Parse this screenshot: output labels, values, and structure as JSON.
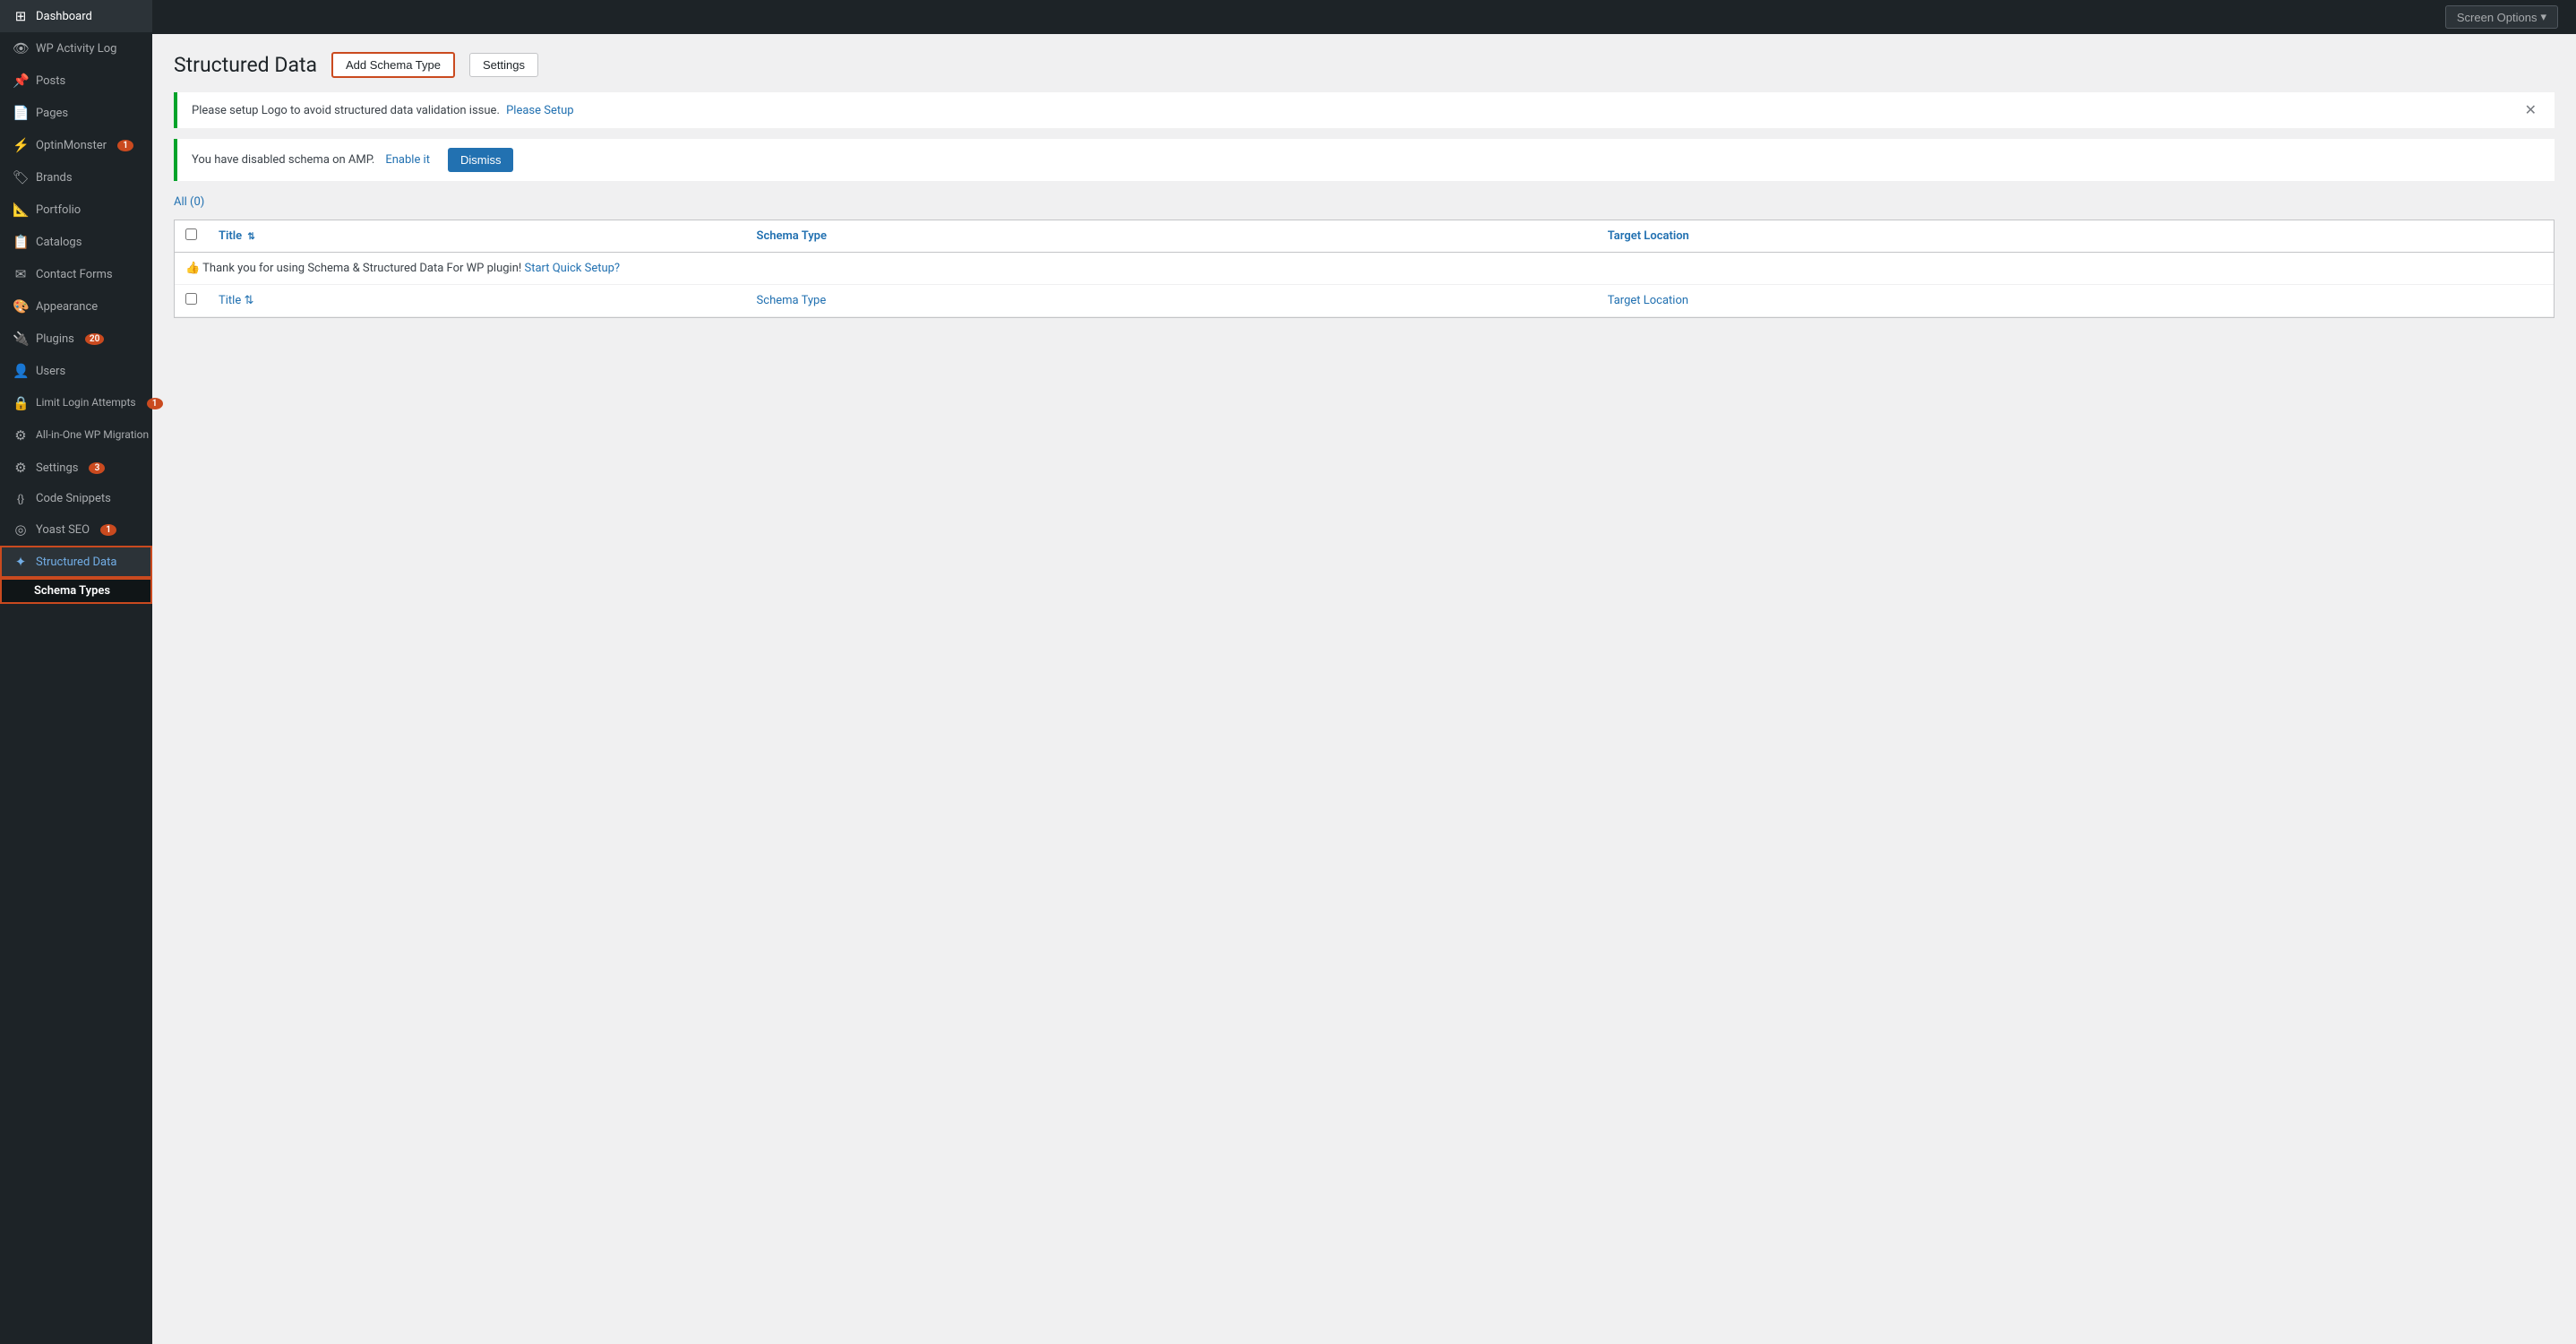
{
  "topbar": {
    "screen_options": "Screen Options",
    "chevron": "▾"
  },
  "sidebar": {
    "items": [
      {
        "id": "dashboard",
        "icon": "⊞",
        "label": "Dashboard",
        "badge": null
      },
      {
        "id": "wp-activity-log",
        "icon": "👁",
        "label": "WP Activity Log",
        "badge": null
      },
      {
        "id": "posts",
        "icon": "📌",
        "label": "Posts",
        "badge": null
      },
      {
        "id": "pages",
        "icon": "📄",
        "label": "Pages",
        "badge": null
      },
      {
        "id": "optinmonster",
        "icon": "⚡",
        "label": "OptinMonster",
        "badge": "1"
      },
      {
        "id": "brands",
        "icon": "🏷",
        "label": "Brands",
        "badge": null
      },
      {
        "id": "portfolio",
        "icon": "📐",
        "label": "Portfolio",
        "badge": null
      },
      {
        "id": "catalogs",
        "icon": "📋",
        "label": "Catalogs",
        "badge": null
      },
      {
        "id": "contact-forms",
        "icon": "✉",
        "label": "Contact Forms",
        "badge": null
      },
      {
        "id": "appearance",
        "icon": "🎨",
        "label": "Appearance",
        "badge": null
      },
      {
        "id": "plugins",
        "icon": "🔌",
        "label": "Plugins",
        "badge": "20"
      },
      {
        "id": "users",
        "icon": "👤",
        "label": "Users",
        "badge": null
      },
      {
        "id": "limit-login",
        "icon": "🔒",
        "label": "Limit Login Attempts",
        "badge": "1"
      },
      {
        "id": "all-in-one",
        "icon": "⚙",
        "label": "All-in-One WP Migration",
        "badge": null
      },
      {
        "id": "settings",
        "icon": "⚙",
        "label": "Settings",
        "badge": "3"
      },
      {
        "id": "code-snippets",
        "icon": "{ }",
        "label": "Code Snippets",
        "badge": null
      },
      {
        "id": "yoast-seo",
        "icon": "◎",
        "label": "Yoast SEO",
        "badge": "1"
      },
      {
        "id": "structured-data",
        "icon": "✦",
        "label": "Structured Data",
        "badge": null
      }
    ],
    "sub_items": [
      {
        "id": "schema-types",
        "label": "Schema Types",
        "active": true
      }
    ]
  },
  "page": {
    "title": "Structured Data",
    "add_schema_button": "Add Schema Type",
    "settings_button": "Settings"
  },
  "notices": {
    "logo_notice": "Please setup Logo to avoid structured data validation issue.",
    "logo_link": "Please Setup",
    "amp_notice": "You have disabled schema on AMP.",
    "amp_link": "Enable it",
    "dismiss_button": "Dismiss"
  },
  "filter": {
    "all_label": "All",
    "count": "(0)"
  },
  "table": {
    "columns": [
      {
        "id": "title",
        "label": "Title",
        "sort": true
      },
      {
        "id": "schema-type",
        "label": "Schema Type",
        "sort": false
      },
      {
        "id": "target-location",
        "label": "Target Location",
        "sort": false
      }
    ],
    "message_row": "👍 Thank you for using Schema & Structured Data For WP plugin!",
    "message_link": "Start Quick Setup?",
    "rows": []
  }
}
